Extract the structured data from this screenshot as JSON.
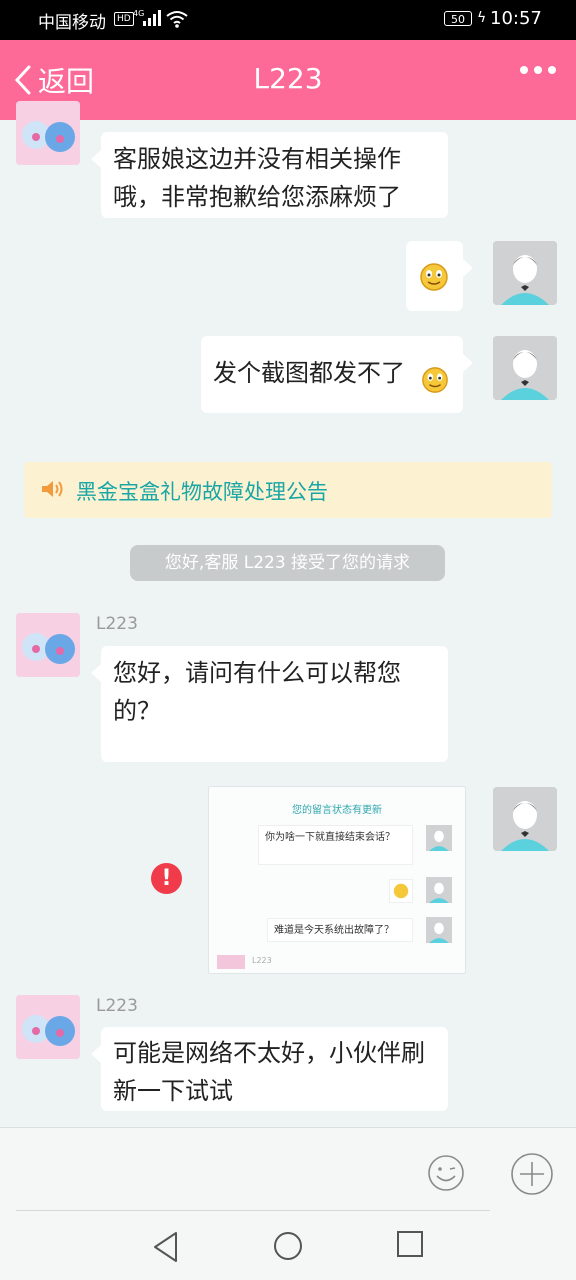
{
  "status_bar": {
    "carrier": "中国移动",
    "hd_badge": "HD",
    "network": "4G",
    "battery": "50",
    "time": "10:57"
  },
  "header": {
    "back_label": "返回",
    "title": "L223",
    "more_icon": "more-dots-icon"
  },
  "messages": {
    "m1_text": "客服娘这边并没有相关操作哦，非常抱歉给您添麻烦了",
    "m4_text": "发个截图都发不了",
    "notice_text": "黑金宝盒礼物故障处理公告",
    "system_text": "您好,客服 L223 接受了您的请求",
    "agent_name": "L223",
    "m5_text": "您好，请问有什么可以帮您的？",
    "m7_text": "可能是网络不太好，小伙伴刷新一下试试"
  },
  "image_message": {
    "title": "您的留言状态有更新",
    "bubble1": "你为啥一下就直接结束会话？",
    "bubble3": "难道是今天系统出故障了？",
    "footer_name": "L223"
  },
  "error_icon": "!",
  "colors": {
    "header": "#fe6a98",
    "background": "#eef3f3",
    "notice_bg": "#fcf2d2",
    "notice_text": "#1aa6a5",
    "error": "#ef3b4a"
  }
}
